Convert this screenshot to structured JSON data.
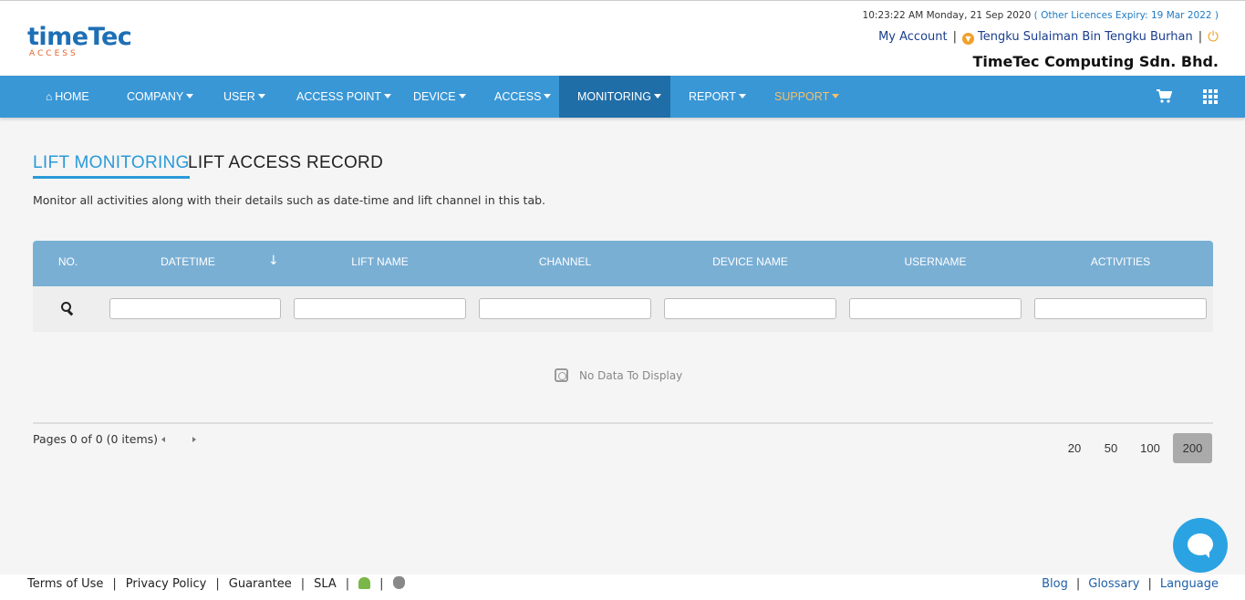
{
  "header": {
    "logo": {
      "name": "timeTec",
      "sub": "ACCESS"
    },
    "time": "10:23:22 AM Monday, 21 Sep 2020",
    "licence": "( Other Licences Expiry:  19 Mar 2022 )",
    "my_account": "My Account",
    "user": "Tengku Sulaiman Bin Tengku Burhan",
    "company": "TimeTec Computing Sdn. Bhd.",
    "accent": "#f0a02a"
  },
  "nav": {
    "bg": "#3a97d6",
    "items": [
      {
        "label": "HOME"
      },
      {
        "label": "COMPANY"
      },
      {
        "label": "USER"
      },
      {
        "label": "ACCESS POINT"
      },
      {
        "label": "DEVICE"
      },
      {
        "label": "ACCESS"
      },
      {
        "label": "MONITORING"
      },
      {
        "label": "REPORT"
      },
      {
        "label": "SUPPORT"
      }
    ],
    "active": "MONITORING",
    "right_icons": [
      "cart-icon",
      "apps-grid-icon"
    ]
  },
  "tabs": [
    {
      "label": "LIFT MONITORING",
      "active": true
    },
    {
      "label": "LIFT ACCESS RECORD",
      "active": false
    }
  ],
  "description": "Monitor all activities along with their details such as date-time and lift channel in this tab.",
  "grid": {
    "columns": [
      "NO.",
      "DATETIME",
      "LIFT NAME",
      "CHANNEL",
      "DEVICE NAME",
      "USERNAME",
      "ACTIVITIES"
    ],
    "sort_indicator": "↓",
    "empty_text": "No Data To Display"
  },
  "pager": {
    "info": "Pages 0 of 0 (0 items)",
    "sizes": [
      "20",
      "50",
      "100",
      "200"
    ],
    "selected": "200"
  },
  "footer": {
    "left": [
      "Terms of Use",
      "Privacy Policy",
      "Guarantee",
      "SLA"
    ],
    "right": [
      "Blog",
      "Glossary",
      "Language"
    ]
  }
}
